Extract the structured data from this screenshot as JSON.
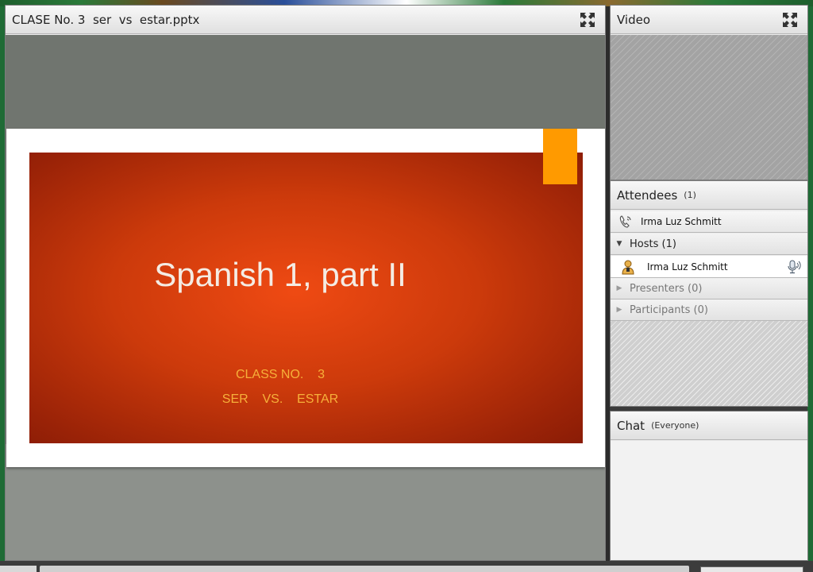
{
  "share_pod": {
    "title": "CLASE No. 3  ser  vs  estar.pptx",
    "slide": {
      "title": "Spanish 1, part II",
      "line1": "CLASS NO.    3",
      "line2": "SER    VS.    ESTAR"
    }
  },
  "video_pod": {
    "title": "Video"
  },
  "attendees_pod": {
    "title": "Attendees",
    "count": "(1)",
    "current_user": "Irma Luz Schmitt",
    "groups": [
      {
        "label": "Hosts (1)",
        "expanded": true
      },
      {
        "label": "Presenters (0)",
        "expanded": false
      },
      {
        "label": "Participants (0)",
        "expanded": false
      }
    ],
    "hosts": [
      "Irma Luz Schmitt"
    ]
  },
  "chat_pod": {
    "title": "Chat",
    "scope": "(Everyone)"
  },
  "colors": {
    "slide_red": "#cc3a0b",
    "slide_accent": "#ff9a00",
    "subtitle_gold": "#f6b03a"
  },
  "icons": [
    "fullscreen-icon",
    "phone-icon",
    "host-user-icon",
    "microphone-icon",
    "triangle-down-icon",
    "triangle-right-icon"
  ]
}
